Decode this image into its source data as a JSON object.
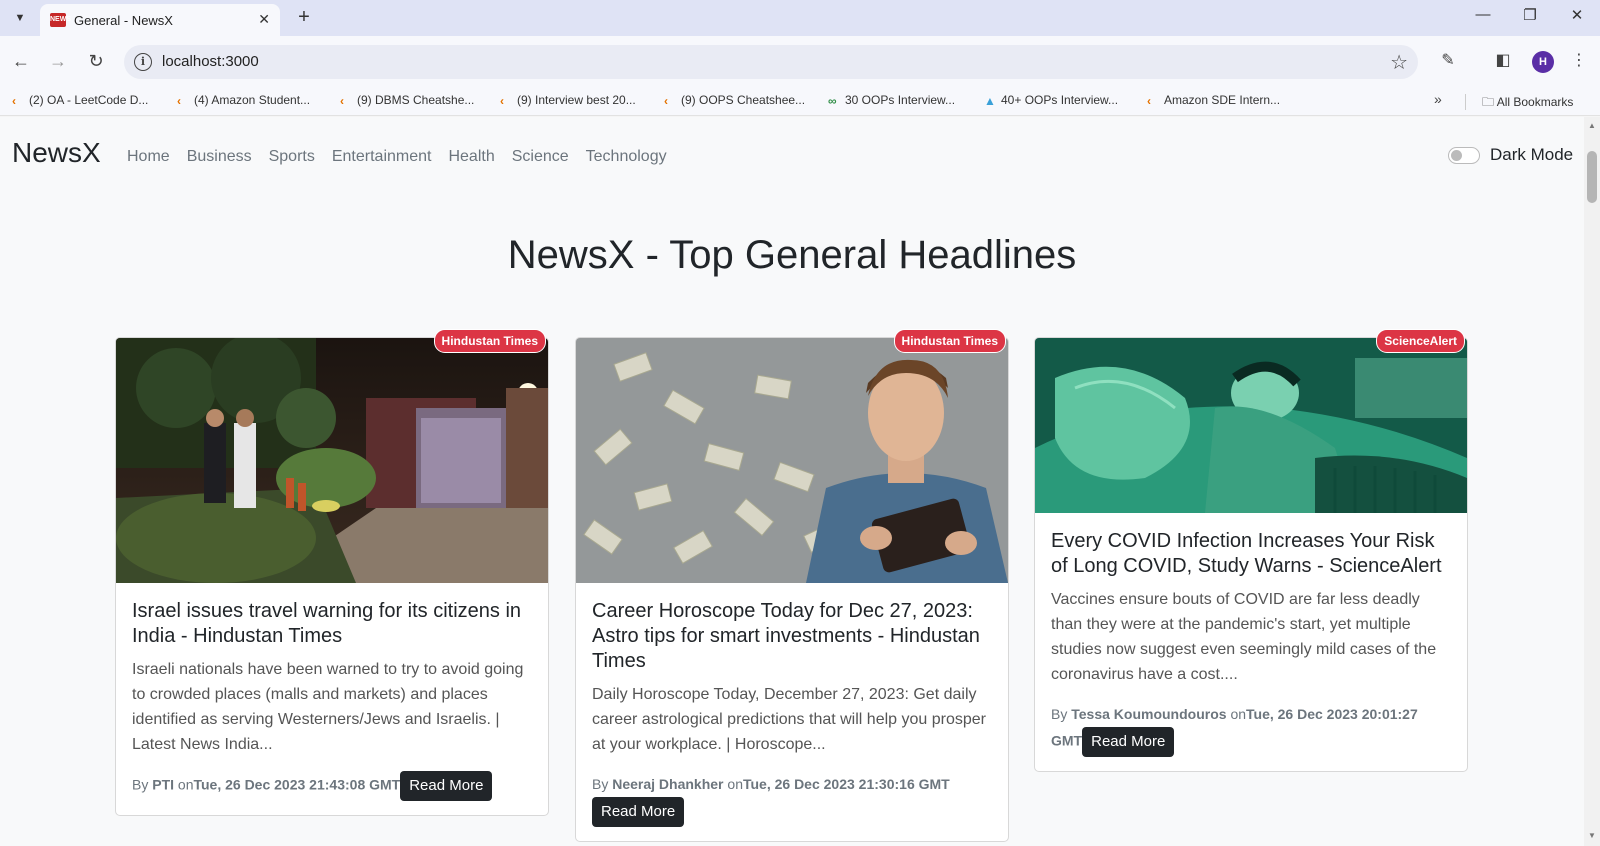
{
  "browser": {
    "tab_title": "General - NewsX",
    "tab_favicon_text": "NEWS",
    "url": "localhost:3000",
    "profile_initial": "H",
    "bookmarks": [
      "(2) OA - LeetCode D...",
      "(4) Amazon Student...",
      "(9) DBMS Cheatshe...",
      "(9) Interview best 20...",
      "(9) OOPS Cheatshee...",
      "30 OOPs Interview...",
      "40+ OOPs Interview...",
      "Amazon SDE Intern..."
    ],
    "all_bookmarks": "All Bookmarks"
  },
  "navbar": {
    "brand": "NewsX",
    "links": [
      "Home",
      "Business",
      "Sports",
      "Entertainment",
      "Health",
      "Science",
      "Technology"
    ],
    "dark_mode_label": "Dark Mode",
    "dark_mode_on": false
  },
  "page": {
    "title": "NewsX - Top General Headlines"
  },
  "articles": [
    {
      "source": "Hindustan Times",
      "title": "Israel issues travel warning for its citizens in India - Hindustan Times",
      "description": "Israeli nationals have been warned to try to avoid going to crowded places (malls and markets) and places identified as serving Westerners/Jews and Israelis. | Latest News India...",
      "by_prefix": "By",
      "author": "PTI",
      "on_prefix": "on",
      "date": "Tue, 26 Dec 2023 21:43:08 GMT",
      "button": "Read More"
    },
    {
      "source": "Hindustan Times",
      "title": "Career Horoscope Today for Dec 27, 2023: Astro tips for smart investments - Hindustan Times",
      "description": "Daily Horoscope Today, December 27, 2023: Get daily career astrological predictions that will help you prosper at your workplace. | Horoscope...",
      "by_prefix": "By",
      "author": "Neeraj Dhankher",
      "on_prefix": "on",
      "date": "Tue, 26 Dec 2023 21:30:16 GMT",
      "button": "Read More"
    },
    {
      "source": "ScienceAlert",
      "title": "Every COVID Infection Increases Your Risk of Long COVID, Study Warns - ScienceAlert",
      "description": "Vaccines ensure bouts of COVID are far less deadly than they were at the pandemic's start, yet multiple studies now suggest even seemingly mild cases of the coronavirus have a cost....",
      "by_prefix": "By",
      "author": "Tessa Koumoundouros",
      "on_prefix": "on",
      "date": "Tue, 26 Dec 2023 20:01:27 GMT",
      "button": "Read More"
    }
  ]
}
